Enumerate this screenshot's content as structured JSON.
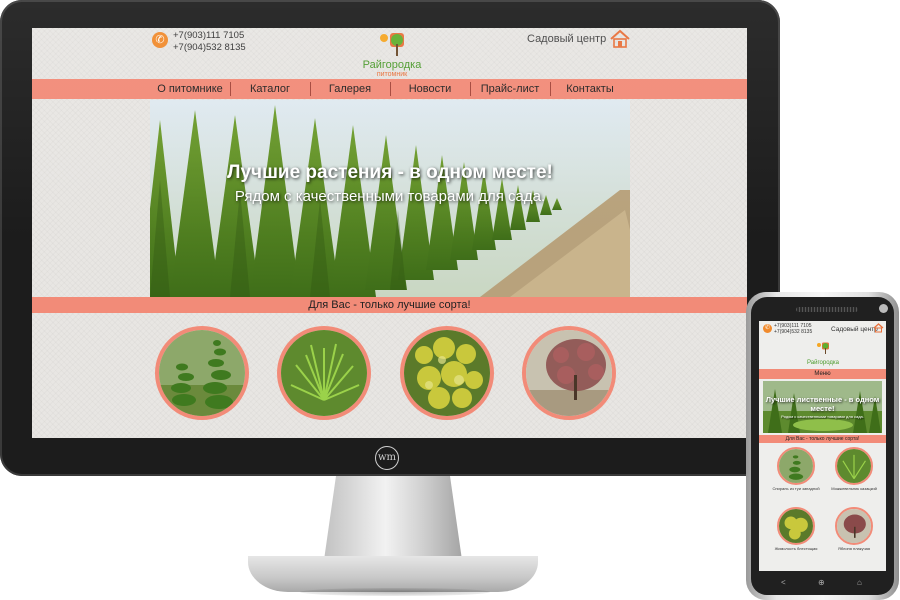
{
  "site": {
    "phones": [
      "+7(903)111 7105",
      "+7(904)532 8135"
    ],
    "logo_name": "Райгородка",
    "logo_sub": "питомник",
    "header_right": "Садовый центр",
    "nav": [
      "О питомнике",
      "Каталог",
      "Галерея",
      "Новости",
      "Прайс-лист",
      "Контакты"
    ],
    "hero_title": "Лучшие растения - в одном месте!",
    "hero_subtitle": "Рядом с качественными товарами для сада.",
    "band_text": "Для Вас - только лучшие сорта!",
    "circles": [
      "spiral-thuja",
      "juniper",
      "golden-shrub",
      "weeping-apple"
    ]
  },
  "mobile": {
    "phones": [
      "+7(903)111 7105",
      "+7(904)532 8135"
    ],
    "header_right": "Садовый центр",
    "logo_name": "Райгородка",
    "logo_sub": "питомник",
    "menu": "Меню",
    "hero_title": "Лучшие лиственные - в одном месте!",
    "hero_subtitle": "Рядом с качественными товарами для сада.",
    "band_text": "Для Вас - только лучшие сорта!",
    "products": [
      {
        "caption": "Спираль из туи западной"
      },
      {
        "caption": "Можжевельник казацкий"
      },
      {
        "caption": "Жимолость блестящая"
      },
      {
        "caption": "Яблоня плакучая"
      }
    ],
    "buttons": [
      "<",
      "⊕",
      "⌂"
    ]
  },
  "brand": {
    "monogram": "wm"
  },
  "colors": {
    "accent": "#f28b78",
    "phone_icon": "#f08a2c",
    "logo_green": "#4b9a2b"
  }
}
